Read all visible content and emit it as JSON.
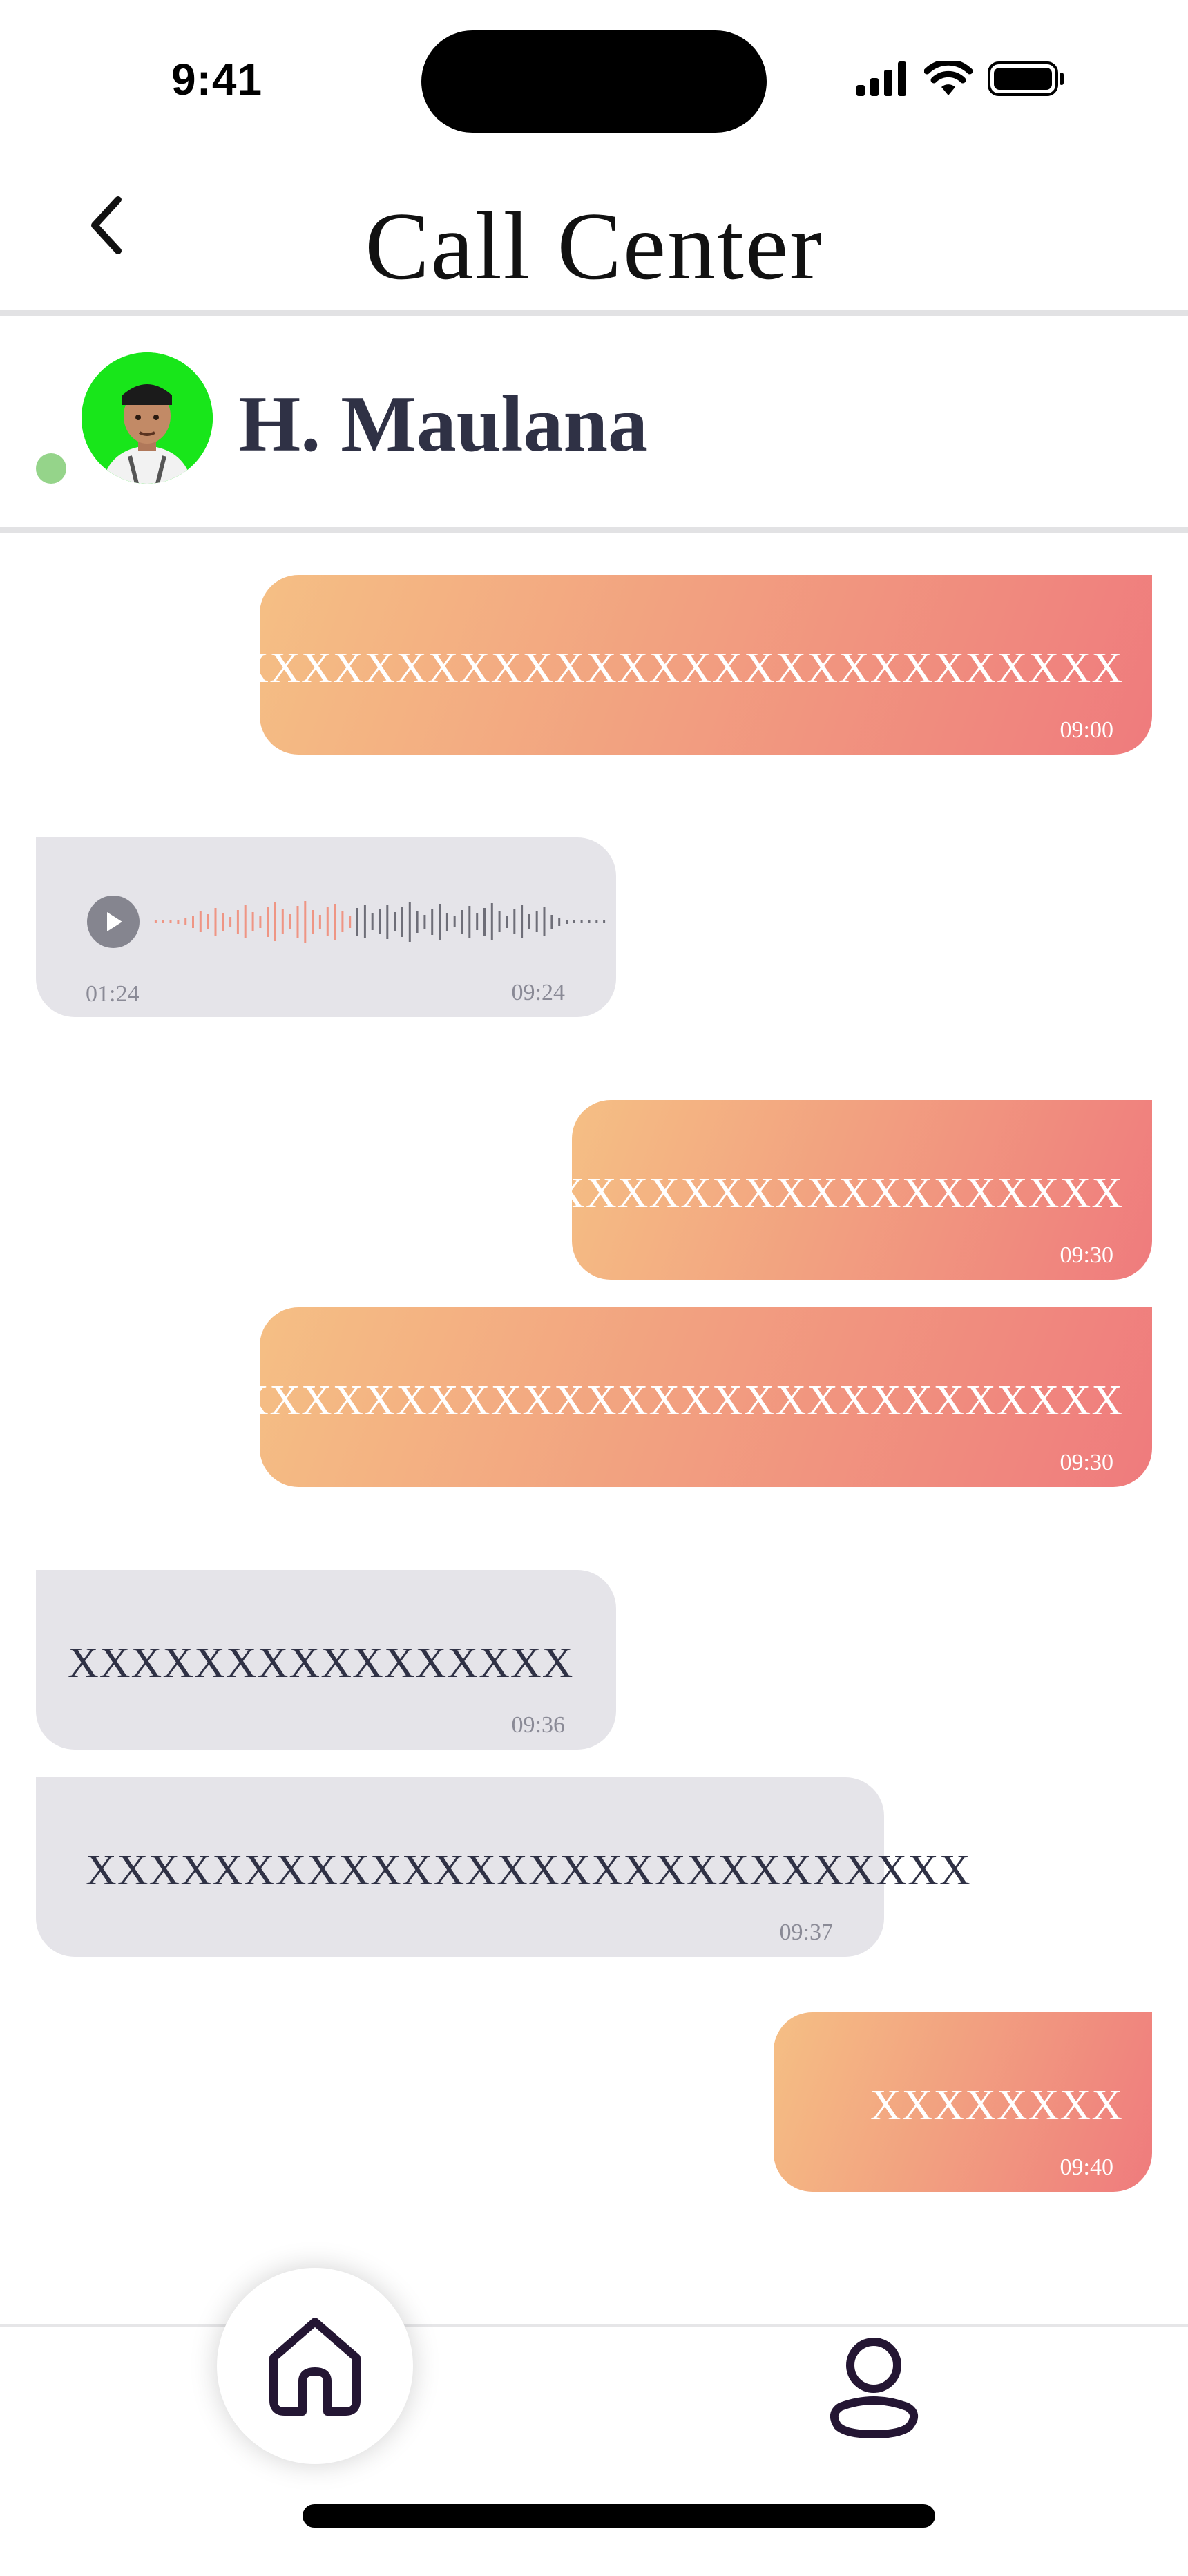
{
  "status_bar": {
    "time": "9:41"
  },
  "header": {
    "title": "Call Center"
  },
  "contact": {
    "name": "H. Maulana",
    "online": true
  },
  "colors": {
    "outgoing_gradient_start": "#f5bf84",
    "outgoing_gradient_end": "#ef7b7d",
    "incoming_bubble": "#e5e4e9",
    "online_indicator": "#95d48a",
    "avatar_background": "#18e61a"
  },
  "messages": [
    {
      "direction": "out",
      "text": "XXXXXXXXXXXXXXXXXXXXXXXXXXXXX",
      "time": "09:00"
    },
    {
      "direction": "in",
      "type": "voice",
      "duration": "01:24",
      "time": "09:24"
    },
    {
      "direction": "out",
      "text": "XXXXXXXXXXXXXXXXXX",
      "time": "09:30"
    },
    {
      "direction": "out",
      "text": "XXXXXXXXXXXXXXXXXXXXXXXXXXXXX",
      "time": "09:30"
    },
    {
      "direction": "in",
      "text": "XXXXXXXXXXXXXXXX",
      "time": "09:36"
    },
    {
      "direction": "in",
      "text": "XXXXXXXXXXXXXXXXXXXXXXXXXXXX",
      "time": "09:37"
    },
    {
      "direction": "out",
      "text": "XXXXXXXX",
      "time": "09:40"
    }
  ],
  "icons": {
    "back": "chevron-left-icon",
    "play": "play-icon",
    "home": "home-icon",
    "profile": "user-icon"
  }
}
